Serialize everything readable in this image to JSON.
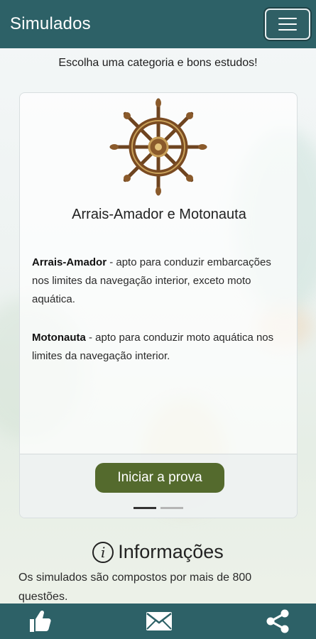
{
  "header": {
    "title": "Simulados",
    "menu_icon": "hamburger-menu-icon"
  },
  "subtitle": "Escolha uma categoria e bons estudos!",
  "card": {
    "image_icon": "ship-wheel-icon",
    "title": "Arrais-Amador e Motonauta",
    "descriptions": [
      {
        "term": "Arrais-Amador",
        "text": " - apto para conduzir embarcações nos limites da navegação interior, exceto moto aquática."
      },
      {
        "term": "Motonauta",
        "text": " - apto para conduzir moto aquática nos limites da navegação interior."
      }
    ],
    "button_label": "Iniciar a prova",
    "carousel": {
      "pages": 2,
      "active_index": 0
    }
  },
  "info": {
    "icon": "info-icon",
    "icon_glyph": "i",
    "heading": "Informações",
    "text": "Os simulados são compostos por mais de 800 questões."
  },
  "bottom_nav": [
    {
      "icon": "thumbs-up-icon"
    },
    {
      "icon": "mail-icon"
    },
    {
      "icon": "share-icon"
    }
  ],
  "colors": {
    "primary": "#2d6167",
    "button": "#546a2d",
    "wheel_wood": "#8a5a2b",
    "wheel_gold": "#c9a15a"
  }
}
